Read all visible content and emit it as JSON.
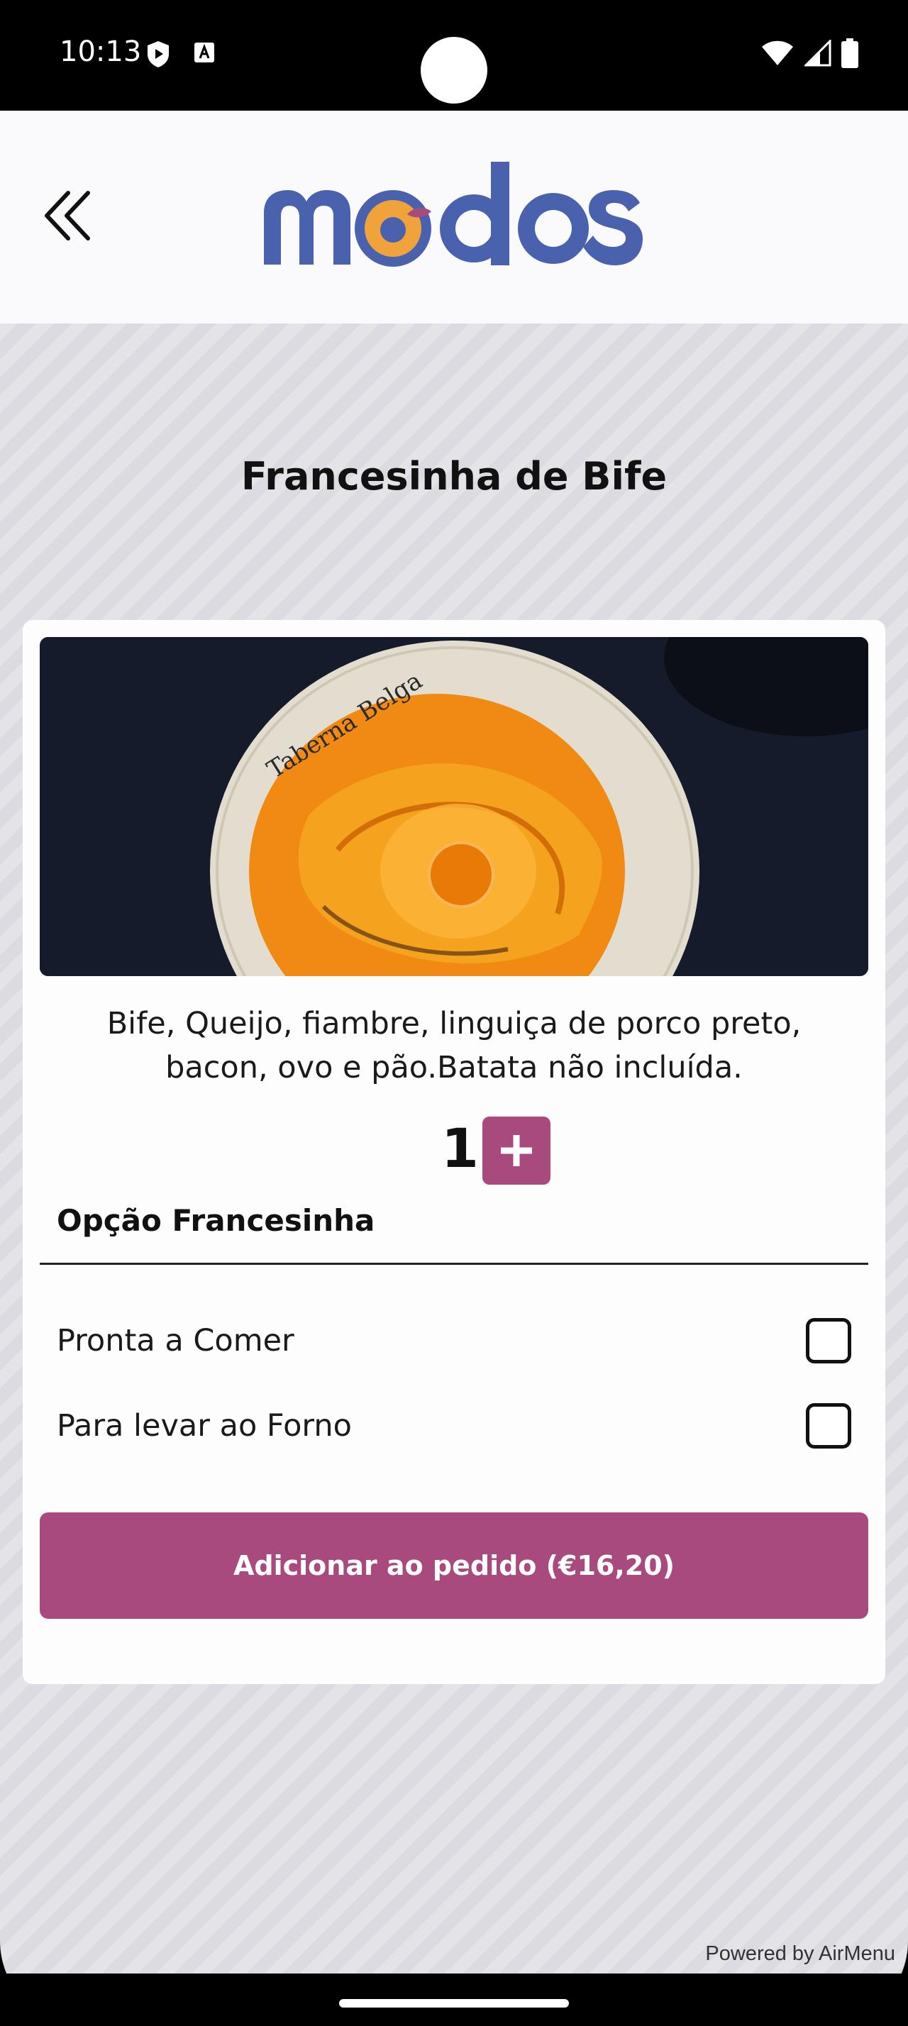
{
  "status_bar": {
    "time": "10:13"
  },
  "header": {
    "logo_text": "modos",
    "back_icon": "double-chevron-left-icon"
  },
  "product": {
    "title": "Francesinha de Bife",
    "plate_text": "Taberna Belga",
    "description": "Bife, Queijo, fiambre, linguiça de porco preto, bacon, ovo e pão.Batata não incluída.",
    "quantity": "1"
  },
  "options": {
    "section_title": "Opção Francesinha",
    "items": [
      {
        "label": "Pronta a Comer",
        "checked": false
      },
      {
        "label": "Para levar ao Forno",
        "checked": false
      }
    ]
  },
  "actions": {
    "add_to_order": "Adicionar ao pedido (€16,20)"
  },
  "footer": {
    "powered_by": "Powered by AirMenu"
  },
  "colors": {
    "accent": "#a94a7e",
    "logo_blue": "#4a62ad",
    "logo_orange": "#f0a33b"
  }
}
